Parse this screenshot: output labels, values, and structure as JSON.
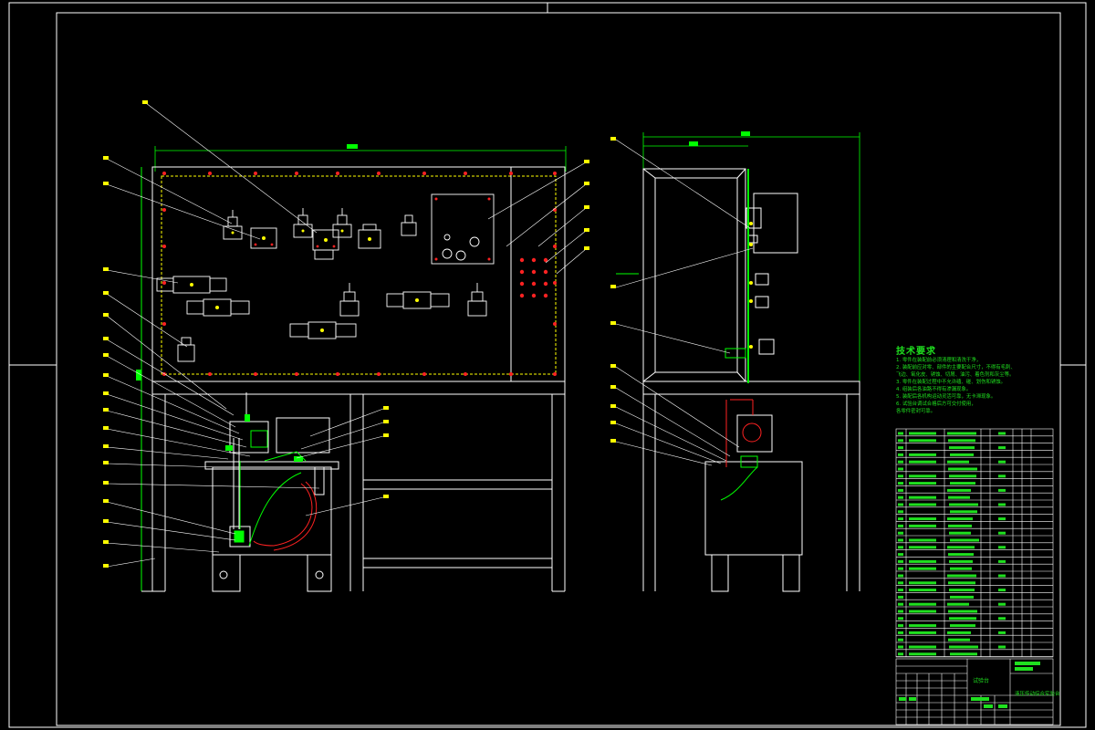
{
  "technical_requirements": {
    "title": "技术要求",
    "lines": [
      "1. 零件在装配前必须清理和清洗干净，",
      "2. 装配前应对零、部件的主要配合尺寸，不得有毛刺、",
      "   飞边、氧化皮、锈蚀、切屑、油污、着色剂和灰尘等。",
      "3. 零件在装配过程中不允许磕、碰、划伤和锈蚀。",
      "4. 组装后各油路不得有渗漏现象。",
      "5. 装配后各机构运动灵活可靠，无卡滞现象。",
      "6. 试验台调试合格后方可交付使用，",
      "   各零件密封可靠。"
    ]
  },
  "title_block": {
    "name": "试验台",
    "drawing_title": "液压传动综合实验台"
  },
  "colors": {
    "background": "#000000",
    "outline": "#ffffff",
    "green": "#00ff00",
    "red": "#ff2222",
    "yellow": "#ffff00",
    "magenta": "#ff00ff",
    "cyan": "#00ffff"
  }
}
